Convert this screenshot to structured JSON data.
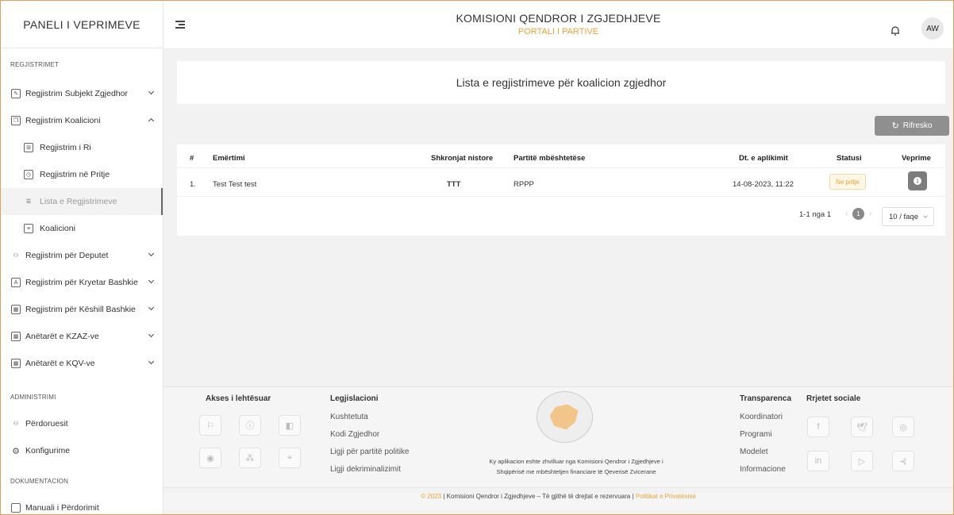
{
  "header": {
    "panel_title": "PANELI I VEPRIMEVE",
    "org_title": "KOMISIONI QENDROR I ZGJEDHJEVE",
    "portal_title": "PORTALI I PARTIVE",
    "avatar_initials": "AW"
  },
  "sidebar": {
    "section_registrations": "REGJISTRIMET",
    "section_admin": "ADMINISTRIMI",
    "section_docs": "DOKUMENTACION",
    "items": {
      "subjekt": "Regjistrim Subjekt Zgjedhor",
      "koalicioni": "Regjistrim Koalicioni",
      "regjistrim_ri": "Regjistrim i Ri",
      "ne_pritje": "Regjistrim në Pritje",
      "lista": "Lista e Regjistrimeve",
      "koalicioni_sub": "Koalicioni",
      "deputet": "Regjistrim për Deputet",
      "kryetar": "Regjistrim për Kryetar Bashkie",
      "keshill": "Regjistrim për Këshill Bashkie",
      "kzaz": "Anëtarët e KZAZ-ve",
      "kqv": "Anëtarët e KQV-ve",
      "perdoruesit": "Përdoruesit",
      "konfigurime": "Konfigurime",
      "manuali": "Manuali i Përdorimit"
    }
  },
  "main": {
    "title": "Lista e regjistrimeve për koalicion zgjedhor",
    "refresh_label": "Rifresko",
    "table": {
      "headers": [
        "#",
        "Emërtimi",
        "Shkronjat nistore",
        "Partitë mbështetëse",
        "Dt. e aplikimit",
        "Statusi",
        "Veprime"
      ],
      "rows": [
        {
          "num": "1.",
          "name": "Test Test test",
          "initials": "TTT",
          "parties": "RPPP",
          "date": "14-08-2023, 11:22",
          "status": "Ne pritje"
        }
      ]
    },
    "pager": {
      "summary": "1-1 nga 1",
      "current": "1",
      "page_size": "10 / faqe"
    }
  },
  "footer": {
    "accessibility_title": "Akses i lehtësuar",
    "legislation_title": "Legjislacioni",
    "legislation_links": [
      "Kushtetuta",
      "Kodi Zgjedhor",
      "Ligji për partitë politike",
      "Ligji dekriminalizimit"
    ],
    "transparency_title": "Transparenca",
    "transparency_links": [
      "Koordinatori",
      "Programi",
      "Modelet",
      "Informacione"
    ],
    "social_title": "Rrjetet sociale",
    "note_line1": "Ky aplikacion eshte zhvilluar nga Komisioni Qendror i Zgjedhjeve i",
    "note_line2": "Shqipërisë me mbështetjen financiare të Qeverisë Zvicerane",
    "copyright_year": "© 2023",
    "copyright_text": "| Komisioni Qendror i Zgjedhjeve – Të gjithë të drejtat e rezervuara |",
    "privacy_link": "Politikat e Privatësisë"
  }
}
